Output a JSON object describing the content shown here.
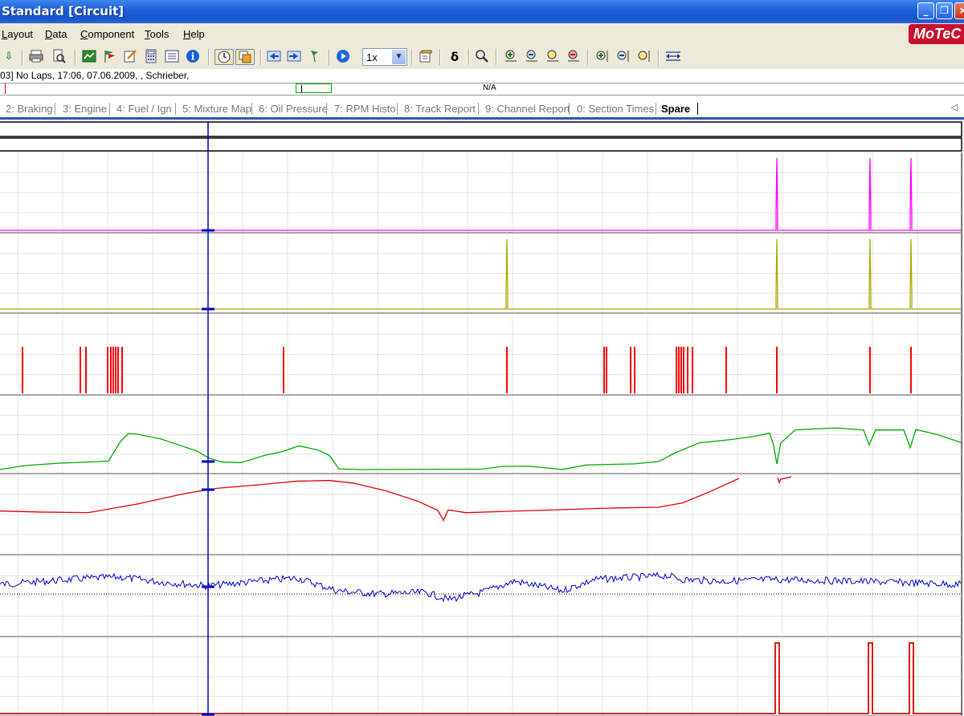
{
  "window": {
    "title": "Standard [Circuit]",
    "buttons": [
      "minimize",
      "restore",
      "close"
    ]
  },
  "menu": {
    "items": [
      {
        "label": "Layout",
        "accel": "L"
      },
      {
        "label": "Data",
        "accel": "D"
      },
      {
        "label": "Component",
        "accel": "C"
      },
      {
        "label": "Tools",
        "accel": "T"
      },
      {
        "label": "Help",
        "accel": "H"
      }
    ],
    "logo_text": "MoTeC"
  },
  "toolbar": {
    "icons": [
      "down-arrow-icon",
      "print-icon",
      "print-preview-icon",
      "graph-icon",
      "flags-icon",
      "edit-icon",
      "calculator-icon",
      "list-icon",
      "info-icon",
      "clock-icon",
      "overlay-icon",
      "step-back-icon",
      "step-forward-icon",
      "marker-flag-icon",
      "play-icon",
      "speed-select",
      "properties-icon",
      "delta-icon",
      "zoom-icon",
      "zoom-in-icon",
      "zoom-out-icon",
      "zoom-fit-icon",
      "zoom-reset-icon",
      "zoom-in-vertical-icon",
      "zoom-out-vertical-icon",
      "zoom-fit-vertical-icon",
      "expand-icon"
    ],
    "speed": "1x",
    "delta_symbol": "δ"
  },
  "info": {
    "text": "03] No Laps, 17:06, 07.06.2009, , Schrieber,"
  },
  "lapbar": {
    "label": "N/A"
  },
  "tabs": {
    "items": [
      {
        "label": "2: Braking"
      },
      {
        "label": "3: Engine"
      },
      {
        "label": "4: Fuel / Ign"
      },
      {
        "label": "5: Mixture Map"
      },
      {
        "label": "6: Oil Pressure"
      },
      {
        "label": "7: RPM Histo"
      },
      {
        "label": "8: Track Report"
      },
      {
        "label": "9: Channel Report"
      },
      {
        "label": "0: Section Times"
      },
      {
        "label": "Spare",
        "active": true
      }
    ]
  },
  "graph": {
    "cursor_position": 0.216,
    "channel_colors": [
      "#ff00ff",
      "#aaaa00",
      "#ff0000",
      "#00aa00",
      "#e00000",
      "#0000cc",
      "#dd0000"
    ],
    "cursor_color": "#0000c0"
  }
}
